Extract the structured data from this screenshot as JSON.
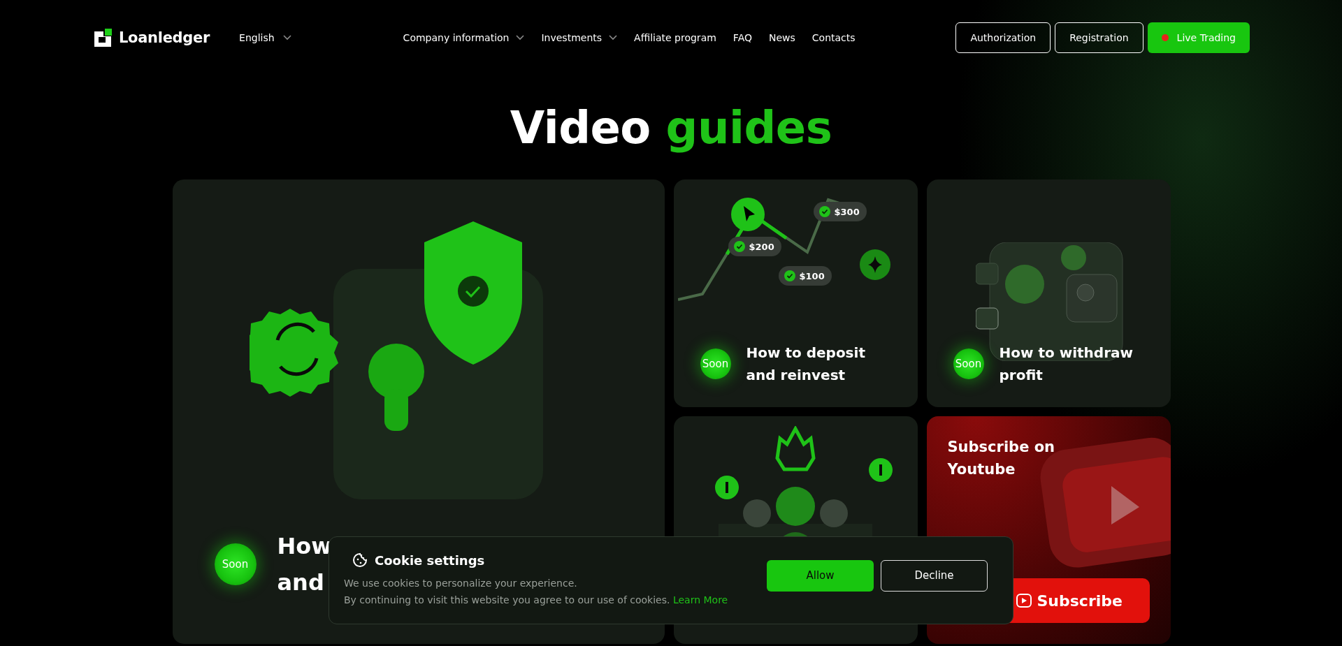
{
  "header": {
    "logo": "Loanledger",
    "language": "English",
    "nav": [
      {
        "label": "Company information",
        "dropdown": true
      },
      {
        "label": "Investments",
        "dropdown": true
      },
      {
        "label": "Affiliate program",
        "dropdown": false
      },
      {
        "label": "FAQ",
        "dropdown": false
      },
      {
        "label": "News",
        "dropdown": false
      },
      {
        "label": "Contacts",
        "dropdown": false
      }
    ],
    "buttons": [
      {
        "label": "Authorization",
        "kind": "outline"
      },
      {
        "label": "Registration",
        "kind": "outline"
      },
      {
        "label": "Live Trading",
        "kind": "live"
      }
    ]
  },
  "heading": {
    "text": "Video",
    "accent": "guides"
  },
  "cards": [
    {
      "kind": "register",
      "badge": "Soon",
      "title_parts": [
        "How",
        "and"
      ]
    },
    {
      "kind": "deposit",
      "badge": "Soon",
      "title": "How to deposit and reinvest",
      "amounts": [
        "$200",
        "$100",
        "$300"
      ]
    },
    {
      "kind": "withdraw",
      "badge": "Soon",
      "title": "How to withdraw profit"
    },
    {
      "kind": "affiliate"
    },
    {
      "kind": "youtube",
      "title": "Subscribe on Youtube",
      "button": "Subscribe"
    }
  ],
  "cookie": {
    "title": "Cookie settings",
    "lines": [
      "We use cookies to personalize your experience.",
      "By continuing to visit this website you agree to our use of cookies."
    ],
    "link": "Learn More",
    "buttons": [
      {
        "label": "Allow",
        "kind": "primary"
      },
      {
        "label": "Decline",
        "kind": "outline"
      }
    ]
  }
}
